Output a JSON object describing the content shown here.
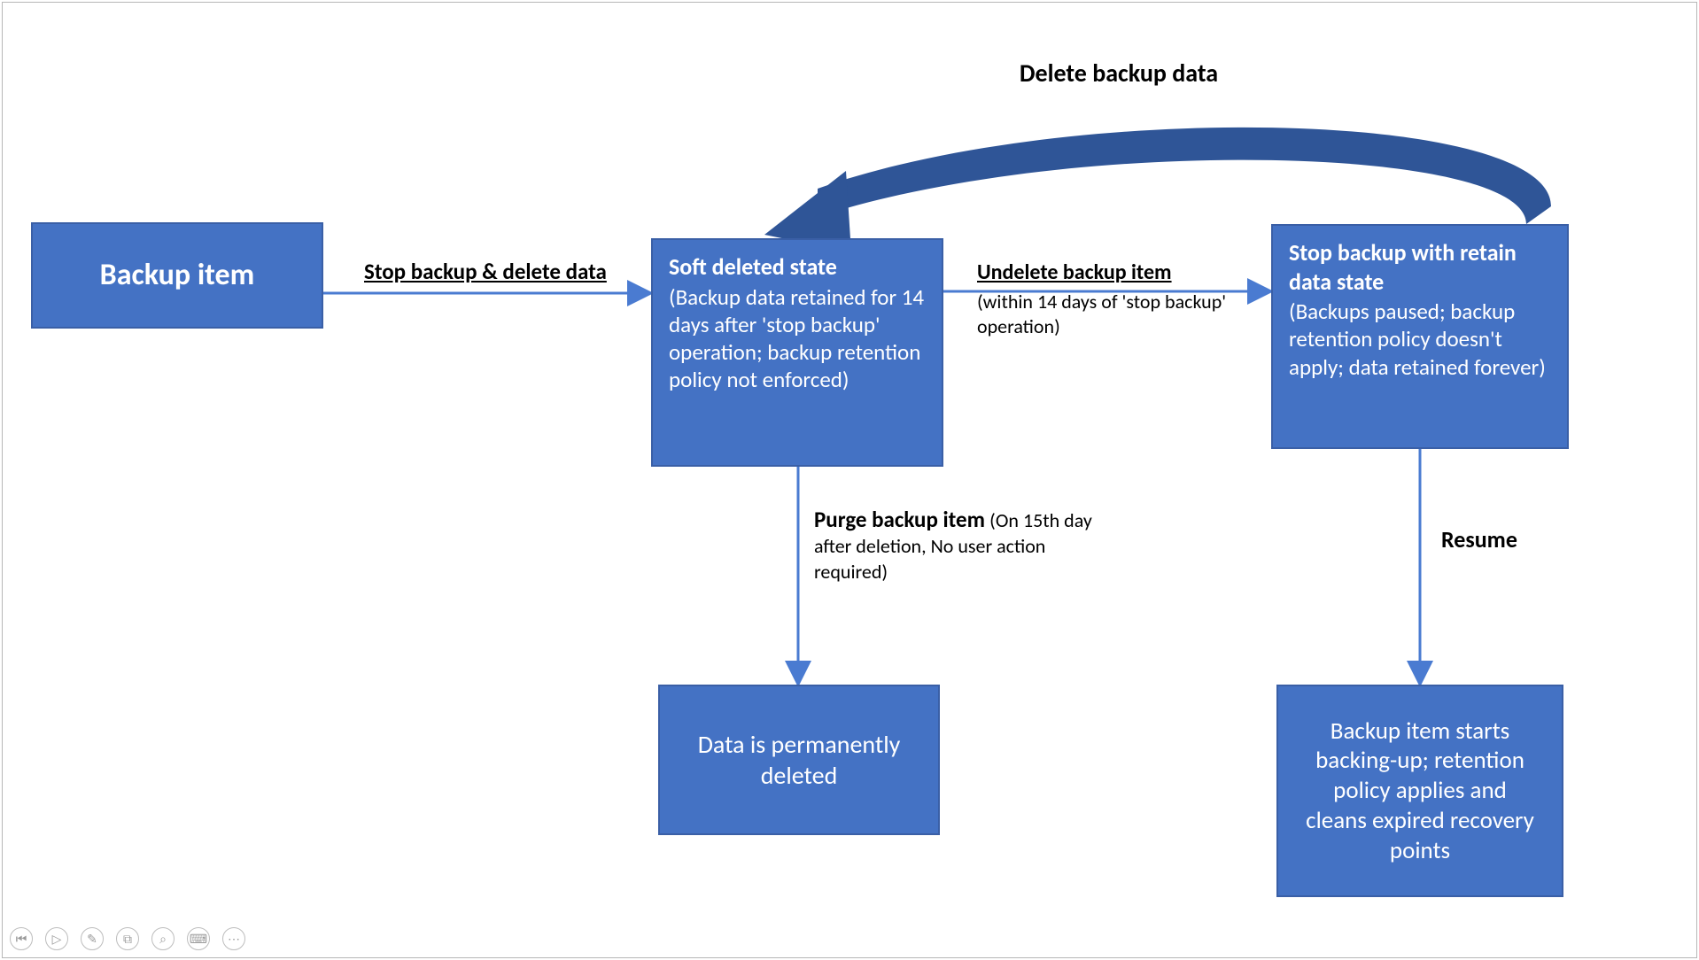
{
  "diagram": {
    "nodes": {
      "backup_item": {
        "title": "Backup item"
      },
      "soft_deleted": {
        "title": "Soft deleted state",
        "sub": "(Backup data retained for 14 days after 'stop backup' operation; backup retention policy not enforced)"
      },
      "retain_data": {
        "title": "Stop backup with retain data state",
        "sub": "(Backups paused; backup retention policy doesn't apply; data retained forever)"
      },
      "perm_deleted": {
        "text": "Data is permanently deleted"
      },
      "resume_result": {
        "text": "Backup item starts backing-up; retention policy applies and cleans expired recovery points"
      }
    },
    "edges": {
      "stop_delete": {
        "bold": "Stop backup & delete data"
      },
      "undelete": {
        "bold": "Undelete backup item",
        "sub": "(within 14 days of 'stop backup' operation)"
      },
      "delete_back": {
        "bold": "Delete backup data"
      },
      "purge": {
        "bold": "Purge backup item",
        "sub": "(On 15th day after deletion, No user action required)"
      },
      "resume": {
        "bold": "Resume"
      }
    }
  },
  "colors": {
    "box_fill": "#4472c4",
    "arrow_blue": "#4a7bd1",
    "curve_fill": "#2f5597"
  },
  "toolbar": {
    "buttons": [
      {
        "name": "first",
        "glyph": "⏮"
      },
      {
        "name": "play",
        "glyph": "▷"
      },
      {
        "name": "pen",
        "glyph": "✎"
      },
      {
        "name": "copy",
        "glyph": "⧉"
      },
      {
        "name": "zoom",
        "glyph": "⌕"
      },
      {
        "name": "keyboard",
        "glyph": "⌨"
      },
      {
        "name": "more",
        "glyph": "⋯"
      }
    ]
  }
}
